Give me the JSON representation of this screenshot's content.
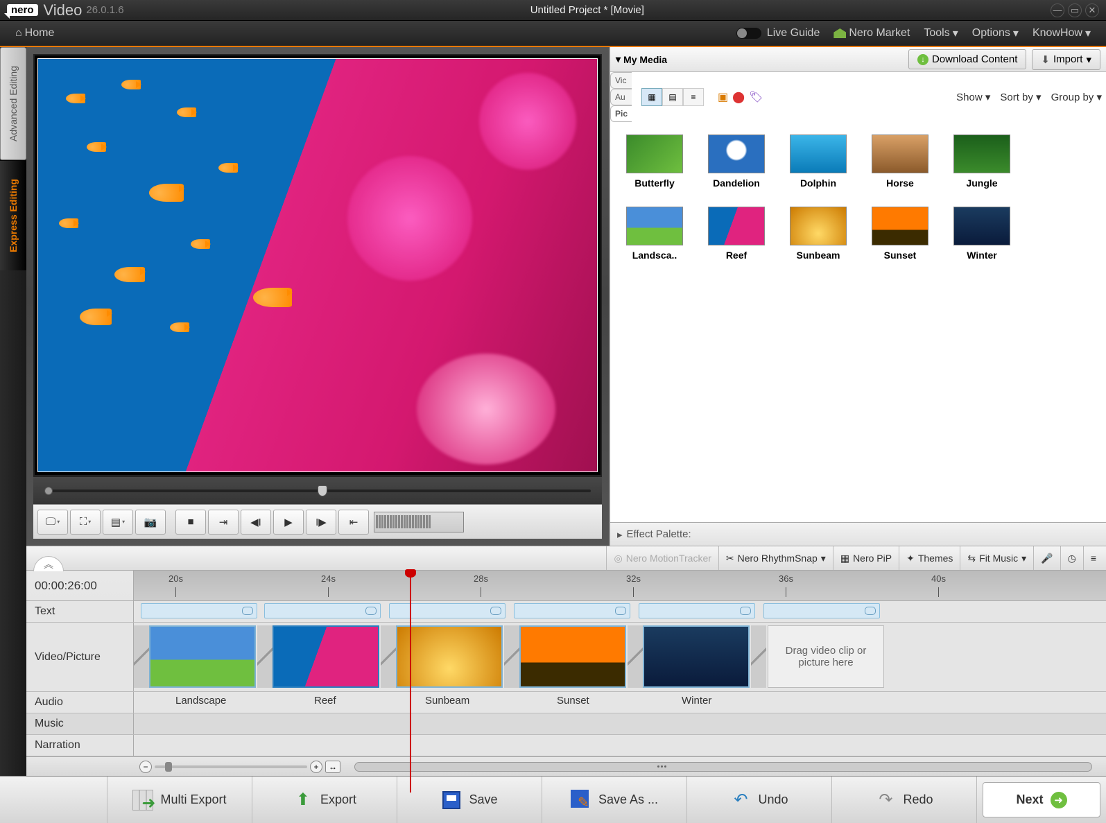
{
  "app": {
    "brand": "nero",
    "product": "Video",
    "version": "26.0.1.6",
    "project": "Untitled Project * [Movie]"
  },
  "menu": {
    "home": "Home",
    "live_guide": "Live Guide",
    "market": "Nero Market",
    "tools": "Tools",
    "options": "Options",
    "knowhow": "KnowHow"
  },
  "side": {
    "advanced": "Advanced Editing",
    "express": "Express Editing"
  },
  "media": {
    "title": "My Media",
    "download": "Download Content",
    "import": "Import",
    "tabs": {
      "video": "Vic",
      "audio": "Au",
      "picture": "Pic"
    },
    "menus": {
      "show": "Show",
      "sort": "Sort by",
      "group": "Group by"
    },
    "items": [
      {
        "label": "Butterfly",
        "cls": "t-butterfly"
      },
      {
        "label": "Dandelion",
        "cls": "t-dandelion"
      },
      {
        "label": "Dolphin",
        "cls": "t-dolphin"
      },
      {
        "label": "Horse",
        "cls": "t-horse"
      },
      {
        "label": "Jungle",
        "cls": "t-jungle"
      },
      {
        "label": "Landsca..",
        "cls": "t-landscape"
      },
      {
        "label": "Reef",
        "cls": "t-reef"
      },
      {
        "label": "Sunbeam",
        "cls": "t-sunbeam"
      },
      {
        "label": "Sunset",
        "cls": "t-sunset"
      },
      {
        "label": "Winter",
        "cls": "t-winter"
      }
    ]
  },
  "effect_palette": "Effect Palette:",
  "ribbon": {
    "motion": "Nero MotionTracker",
    "rhythm": "Nero RhythmSnap",
    "pip": "Nero PiP",
    "themes": "Themes",
    "fit": "Fit Music"
  },
  "timeline": {
    "timecode": "00:00:26:00",
    "ticks": [
      "20s",
      "24s",
      "28s",
      "32s",
      "36s",
      "40s"
    ],
    "rows": {
      "text": "Text",
      "video": "Video/Picture",
      "audio": "Audio",
      "music": "Music",
      "narration": "Narration"
    },
    "clips": [
      "Landscape",
      "Reef",
      "Sunbeam",
      "Sunset",
      "Winter"
    ],
    "dropzone": "Drag video clip or picture here"
  },
  "bottom": {
    "multi": "Multi Export",
    "export": "Export",
    "save": "Save",
    "saveas": "Save As ...",
    "undo": "Undo",
    "redo": "Redo",
    "next": "Next"
  }
}
